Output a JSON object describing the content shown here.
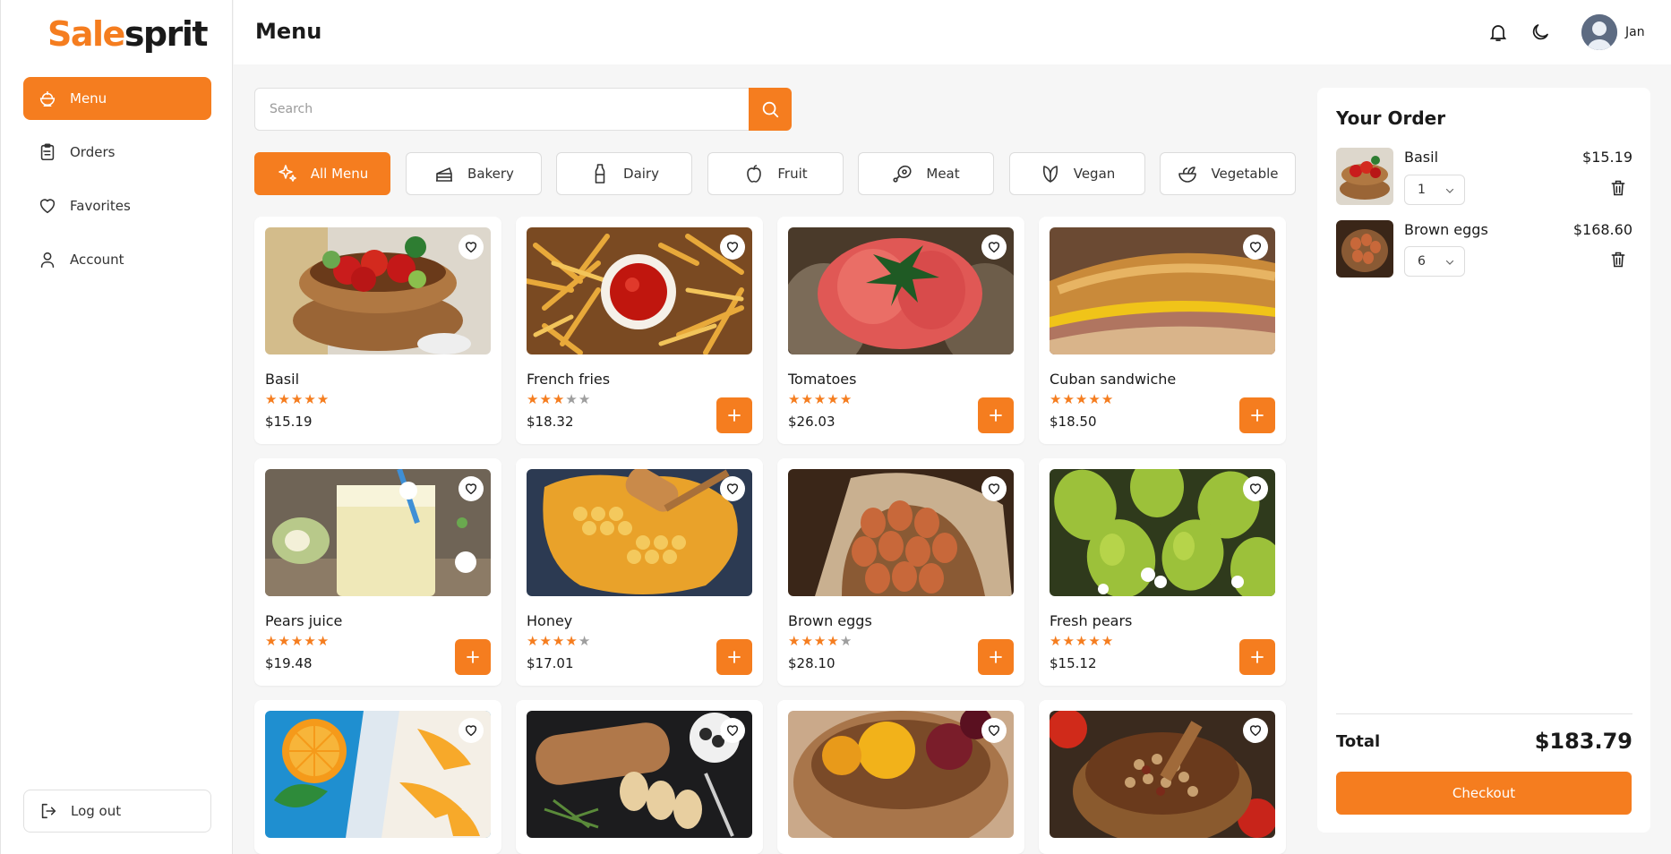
{
  "brand": {
    "part1": "Sale",
    "part2": "sprit"
  },
  "sidebar": {
    "items": [
      {
        "label": "Menu",
        "icon": "dish-icon",
        "active": true
      },
      {
        "label": "Orders",
        "icon": "clipboard-icon"
      },
      {
        "label": "Favorites",
        "icon": "heart-icon"
      },
      {
        "label": "Account",
        "icon": "user-icon"
      }
    ],
    "logout_label": "Log out"
  },
  "header": {
    "title": "Menu",
    "user_name": "Jan"
  },
  "search": {
    "placeholder": "Search",
    "value": ""
  },
  "filters": [
    {
      "label": "All Menu",
      "icon": "sparkle-icon",
      "active": true
    },
    {
      "label": "Bakery",
      "icon": "cake-icon"
    },
    {
      "label": "Dairy",
      "icon": "milk-bottle-icon"
    },
    {
      "label": "Fruit",
      "icon": "apple-icon"
    },
    {
      "label": "Meat",
      "icon": "meat-icon"
    },
    {
      "label": "Vegan",
      "icon": "leaf-icon"
    },
    {
      "label": "Vegetable",
      "icon": "salad-bowl-icon"
    }
  ],
  "products": [
    {
      "name": "Basil",
      "price": "$15.19",
      "rating": 5,
      "in_cart": true,
      "image": "tomatoes-bowl"
    },
    {
      "name": "French fries",
      "price": "$18.32",
      "rating": 3,
      "in_cart": false,
      "image": "fries"
    },
    {
      "name": "Tomatoes",
      "price": "$26.03",
      "rating": 5,
      "in_cart": false,
      "image": "tomato"
    },
    {
      "name": "Cuban sandwiche",
      "price": "$18.50",
      "rating": 5,
      "in_cart": false,
      "image": "sandwich"
    },
    {
      "name": "Pears juice",
      "price": "$19.48",
      "rating": 5,
      "in_cart": false,
      "image": "juice"
    },
    {
      "name": "Honey",
      "price": "$17.01",
      "rating": 4,
      "in_cart": false,
      "image": "honey"
    },
    {
      "name": "Brown eggs",
      "price": "$28.10",
      "rating": 4,
      "in_cart": false,
      "image": "eggs"
    },
    {
      "name": "Fresh pears",
      "price": "$15.12",
      "rating": 5,
      "in_cart": false,
      "image": "pears"
    },
    {
      "name": "",
      "price": "",
      "rating": 0,
      "in_cart": false,
      "image": "oranges"
    },
    {
      "name": "",
      "price": "",
      "rating": 0,
      "in_cart": false,
      "image": "bread"
    },
    {
      "name": "",
      "price": "",
      "rating": 0,
      "in_cart": false,
      "image": "plums"
    },
    {
      "name": "",
      "price": "",
      "rating": 0,
      "in_cart": false,
      "image": "beans"
    }
  ],
  "order": {
    "title": "Your Order",
    "items": [
      {
        "name": "Basil",
        "price": "$15.19",
        "qty": "1",
        "image": "tomatoes-bowl"
      },
      {
        "name": "Brown eggs",
        "price": "$168.60",
        "qty": "6",
        "image": "eggs"
      }
    ],
    "total_label": "Total",
    "total_value": "$183.79",
    "checkout_label": "Checkout"
  },
  "colors": {
    "accent": "#f57d1f",
    "star_on": "#f57d1f",
    "star_off": "#9e9e9e"
  }
}
